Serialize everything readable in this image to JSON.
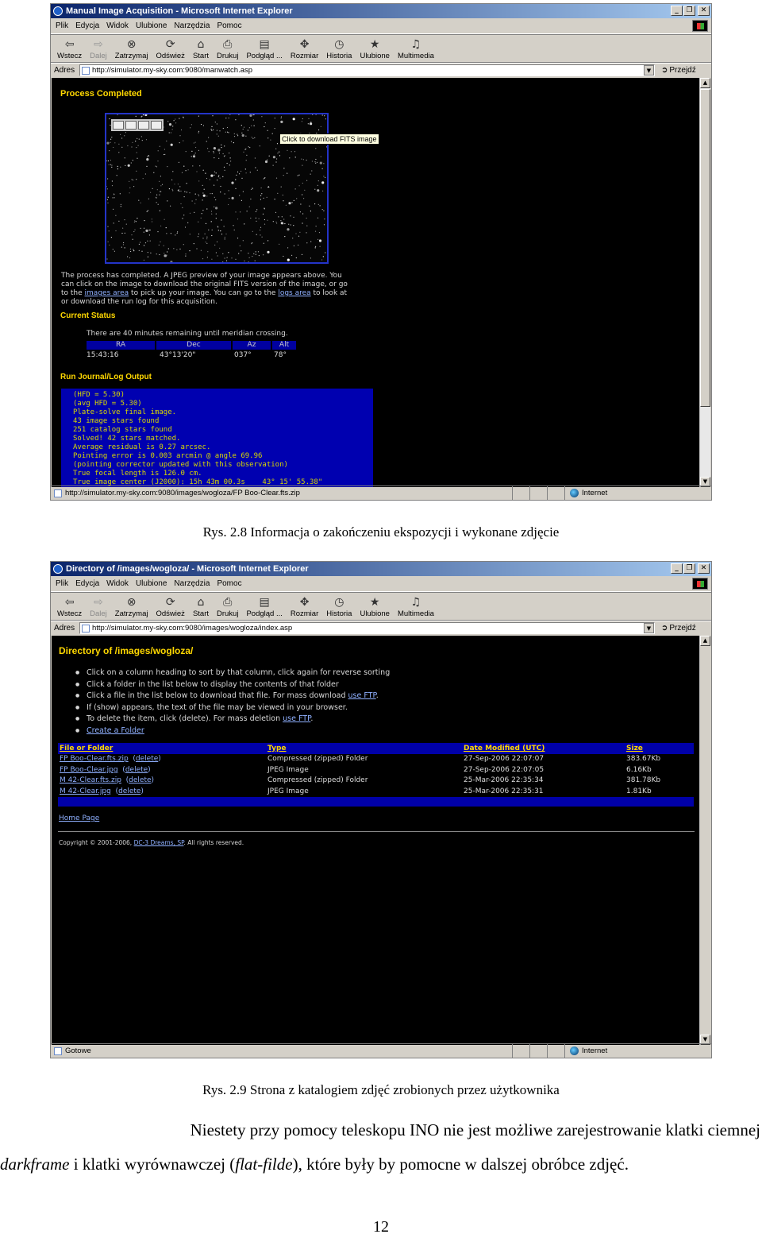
{
  "browser": {
    "menu": [
      "Plik",
      "Edycja",
      "Widok",
      "Ulubione",
      "Narzędzia",
      "Pomoc"
    ],
    "toolbar": [
      {
        "label": "Wstecz",
        "icon": "back-arrow-icon",
        "glyph": "⇦"
      },
      {
        "label": "Dalej",
        "icon": "forward-arrow-icon",
        "glyph": "⇨"
      },
      {
        "label": "Zatrzymaj",
        "icon": "stop-icon",
        "glyph": "⊗"
      },
      {
        "label": "Odśwież",
        "icon": "refresh-icon",
        "glyph": "⟳"
      },
      {
        "label": "Start",
        "icon": "home-icon",
        "glyph": "⌂"
      },
      {
        "label": "Drukuj",
        "icon": "print-icon",
        "glyph": "⎙"
      },
      {
        "label": "Podgląd ...",
        "icon": "preview-icon",
        "glyph": "▤"
      },
      {
        "label": "Rozmiar",
        "icon": "size-icon",
        "glyph": "✥"
      },
      {
        "label": "Historia",
        "icon": "history-icon",
        "glyph": "◷"
      },
      {
        "label": "Ulubione",
        "icon": "favorites-icon",
        "glyph": "★"
      },
      {
        "label": "Multimedia",
        "icon": "multimedia-icon",
        "glyph": "♫"
      }
    ],
    "address_label": "Adres",
    "go_label": "Przejdź",
    "zone_label": "Internet"
  },
  "screenshot1": {
    "window_title": "Manual Image Acquisition - Microsoft Internet Explorer",
    "url": "http://simulator.my-sky.com:9080/manwatch.asp",
    "status_text": "http://simulator.my-sky.com:9080/images/wogloza/FP Boo-Clear.fts.zip",
    "heading": "Process Completed",
    "tooltip": "Click to download FITS image",
    "desc_lines": [
      "The process has completed. A JPEG preview of your image appears above. You",
      "can click on the image to download the original FITS version of the image, or go"
    ],
    "desc_line3_pre": "to the ",
    "desc_link1": "images area",
    "desc_line3_mid": " to pick up your image. You can go to the ",
    "desc_link2": "logs area",
    "desc_line3_post": " to look at",
    "desc_line4": "or download the run log for this acquisition.",
    "status_heading": "Current Status",
    "meridian": "There are 40 minutes remaining until meridian crossing.",
    "status_headers": [
      "RA",
      "Dec",
      "Az",
      "Alt"
    ],
    "status_values": [
      "15:43:16",
      "43°13'20\"",
      "037°",
      "78°"
    ],
    "log_heading": "Run Journal/Log Output",
    "log_lines": [
      "(HFD = 5.30)",
      "(avg HFD = 5.30)",
      "Plate-solve final image.",
      "43 image stars found",
      "251 catalog stars found",
      "Solved! 42 stars matched.",
      "Average residual is 0.27 arcsec.",
      "Pointing error is 0.003 arcmin @ angle 69.96",
      "(pointing corrector updated with this observation)",
      "True focal length is 126.0 cm.",
      "True image center (J2000): 15h 43m 00.3s    43° 15' 55.38\""
    ]
  },
  "caption1": "Rys. 2.8 Informacja o zakończeniu ekspozycji i wykonane zdjęcie",
  "screenshot2": {
    "window_title": "Directory of /images/wogloza/ - Microsoft Internet Explorer",
    "url": "http://simulator.my-sky.com:9080/images/wogloza/index.asp",
    "status_text": "Gotowe",
    "heading": "Directory of /images/wogloza/",
    "bullets": [
      {
        "text": "Click on a column heading to sort by that column, click again for reverse sorting",
        "link": ""
      },
      {
        "text": "Click a folder in the list below to display the contents of that folder",
        "link": ""
      },
      {
        "text": "Click a file in the list below to download that file. For mass download ",
        "link": "use FTP",
        "tail": "."
      },
      {
        "text": "If (show) appears, the text of the file may be viewed in your browser.",
        "link": ""
      },
      {
        "text": "To delete the item, click (delete). For mass deletion ",
        "link": "use FTP",
        "tail": "."
      },
      {
        "text": "",
        "link": "Create a Folder"
      }
    ],
    "columns": [
      "File or Folder",
      "Type",
      "Date Modified (UTC)",
      "Size"
    ],
    "rows": [
      {
        "name": "FP Boo-Clear.fts.zip",
        "del": "delete",
        "type": "Compressed (zipped) Folder",
        "date": "27-Sep-2006 22:07:07",
        "size": "383.67Kb"
      },
      {
        "name": "FP Boo-Clear.jpg",
        "del": "delete",
        "type": "JPEG Image",
        "date": "27-Sep-2006 22:07:05",
        "size": "6.16Kb"
      },
      {
        "name": "M 42-Clear.fts.zip",
        "del": "delete",
        "type": "Compressed (zipped) Folder",
        "date": "25-Mar-2006 22:35:34",
        "size": "381.78Kb"
      },
      {
        "name": "M 42-Clear.jpg",
        "del": "delete",
        "type": "JPEG Image",
        "date": "25-Mar-2006 22:35:31",
        "size": "1.81Kb"
      }
    ],
    "home_link": "Home Page",
    "copyright_pre": "Copyright © 2001-2006, ",
    "copyright_link": "DC-3 Dreams, SP",
    "copyright_post": ". All rights reserved."
  },
  "caption2": "Rys. 2.9 Strona z katalogiem zdjęć zrobionych przez użytkownika",
  "paragraph": {
    "line1": "Niestety  przy  pomocy  teleskopu  INO  nie  jest  możliwe  zarejestrowanie  klatki  ciemnej",
    "term1": "darkframe",
    "mid": " i klatki wyrównawczej  (",
    "term2": "flat-filde",
    "end": "), które były by pomocne w dalszej obróbce zdjęć."
  },
  "page_number": "12"
}
